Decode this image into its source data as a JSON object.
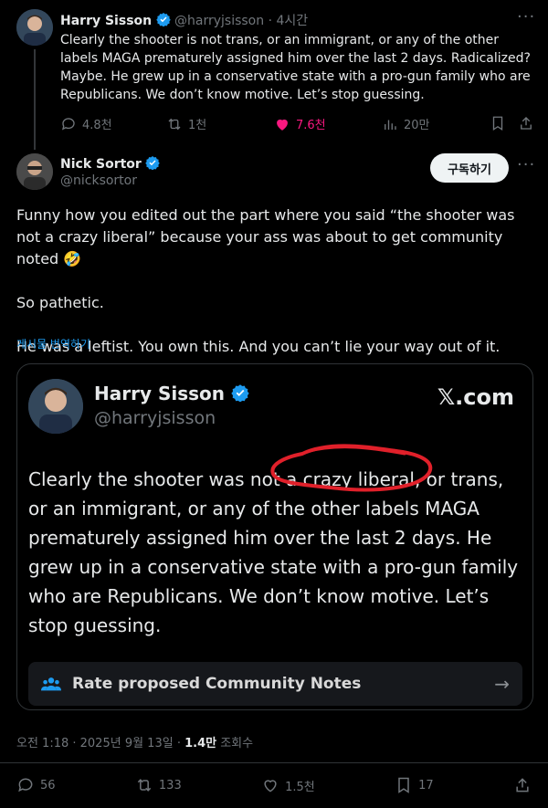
{
  "parent_tweet": {
    "author_name": "Harry Sisson",
    "author_handle": "@harryjsisson",
    "time": "· 4시간",
    "text": "Clearly the shooter is not trans, or an immigrant, or any of the other labels MAGA prematurely assigned him over the last 2 days. Radicalized? Maybe. He grew up in a conservative state with a pro-gun family who are Republicans. We don’t know motive. Let’s stop guessing.",
    "stats": {
      "replies": "4.8천",
      "reposts": "1천",
      "likes": "7.6천",
      "views": "20만"
    }
  },
  "reply": {
    "author_name": "Nick Sortor",
    "author_handle": "@nicksortor",
    "follow_label": "구독하기",
    "paragraphs": [
      "Funny how you edited out the part where you said “the shooter was not a crazy liberal” because your ass was about to get community noted 🤣",
      "So pathetic.",
      "He was a leftist. You own this. And you can’t lie your way out of it."
    ],
    "translate_label": "게시물 번역하기"
  },
  "embedded_card": {
    "author_name": "Harry Sisson",
    "author_handle": "@harryjsisson",
    "logo": "𝕏.com",
    "text": "Clearly the shooter was not a crazy liberal, or trans, or an immigrant, or any of the other labels MAGA prematurely assigned him over the last 2 days. He grew up in a conservative state with a pro-gun family who are Republicans. We don’t know motive. Let’s stop guessing.",
    "notes_label": "Rate proposed Community Notes",
    "notes_arrow": "→"
  },
  "meta": {
    "timestamp": "오전 1:18 · 2025년 9월 13일 · ",
    "views_count": "1.4만",
    "views_label": " 조회수"
  },
  "actions": {
    "replies": "56",
    "reposts": "133",
    "likes": "1.5천",
    "bookmarks": "17"
  },
  "colors": {
    "background": "#000000",
    "accent_blue": "#1d9bf0",
    "like_pink": "#f91880",
    "annotation_red": "#e0202a"
  }
}
